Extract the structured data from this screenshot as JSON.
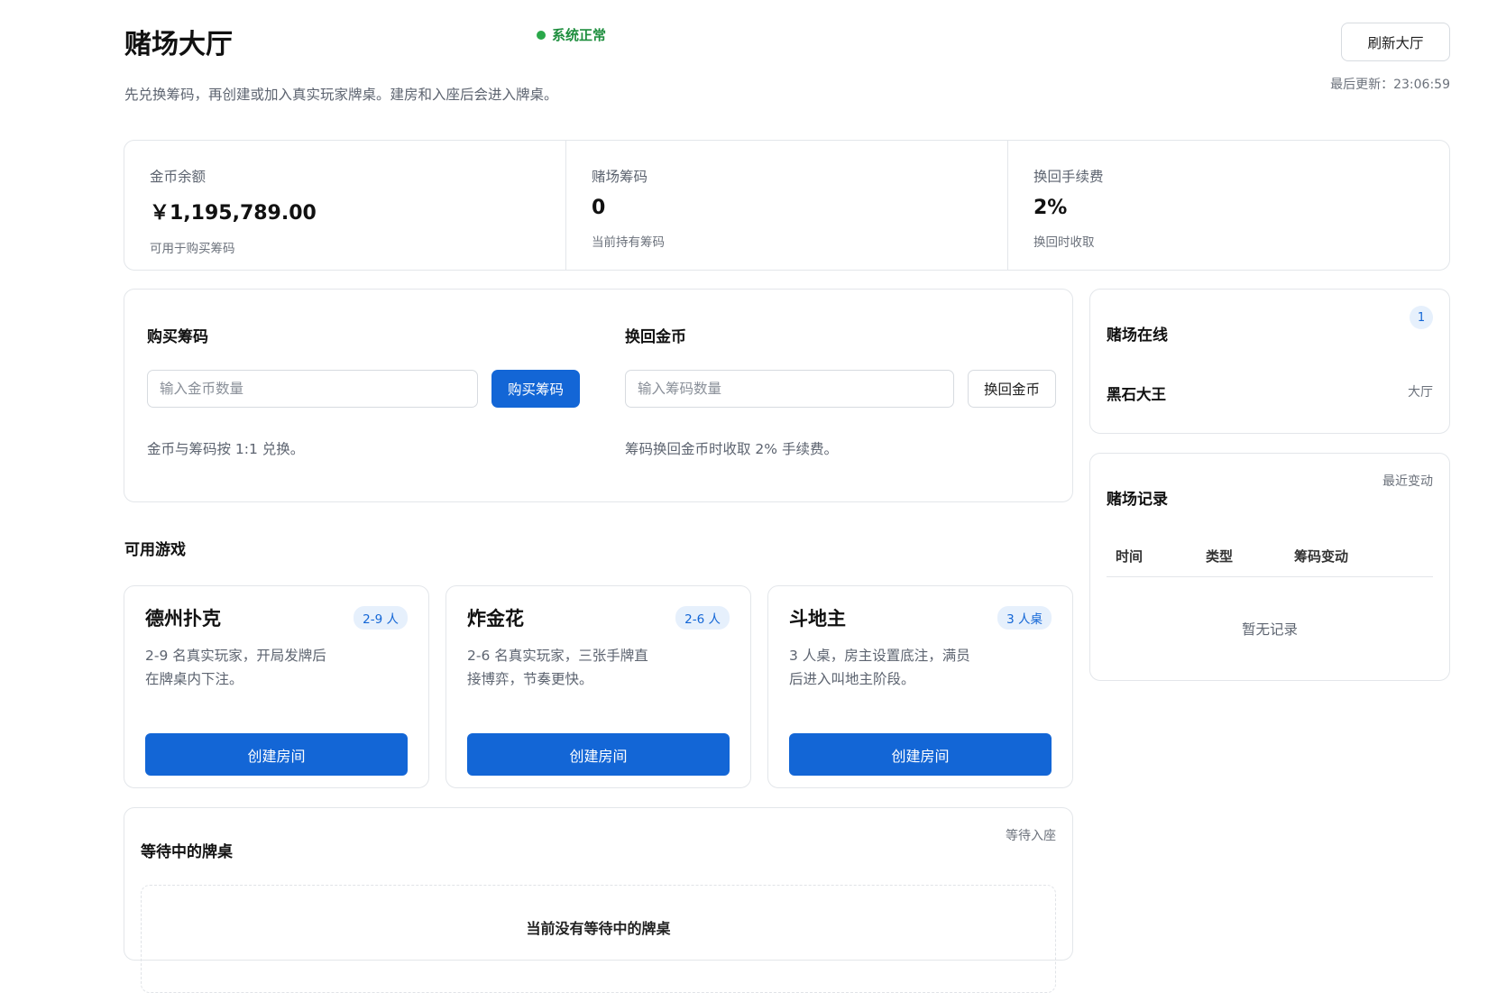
{
  "header": {
    "title": "赌场大厅",
    "status": "系统正常",
    "subtitle": "先兑换筹码，再创建或加入真实玩家牌桌。建房和入座后会进入牌桌。",
    "refresh_label": "刷新大厅",
    "last_update": "最后更新：23:06:59"
  },
  "stats": [
    {
      "label": "金币余额",
      "value": "￥1,195,789.00",
      "hint": "可用于购买筹码"
    },
    {
      "label": "赌场筹码",
      "value": "0",
      "hint": "当前持有筹码"
    },
    {
      "label": "换回手续费",
      "value": "2%",
      "hint": "换回时收取"
    }
  ],
  "buy": {
    "title": "购买筹码",
    "placeholder": "输入金币数量",
    "button": "购买筹码",
    "note": "金币与筹码按 1:1 兑换。"
  },
  "redeem": {
    "title": "换回金币",
    "placeholder": "输入筹码数量",
    "button": "换回金币",
    "note": "筹码换回金币时收取 2% 手续费。"
  },
  "games_title": "可用游戏",
  "games": [
    {
      "name": "德州扑克",
      "badge": "2-9 人",
      "desc": "2-9 名真实玩家，开局发牌后在牌桌内下注。",
      "button": "创建房间"
    },
    {
      "name": "炸金花",
      "badge": "2-6 人",
      "desc": "2-6 名真实玩家，三张手牌直接博弈，节奏更快。",
      "button": "创建房间"
    },
    {
      "name": "斗地主",
      "badge": "3 人桌",
      "desc": "3 人桌，房主设置底注，满员后进入叫地主阶段。",
      "button": "创建房间"
    }
  ],
  "waiting": {
    "title": "等待中的牌桌",
    "side": "等待入座",
    "empty": "当前没有等待中的牌桌"
  },
  "online": {
    "title": "赌场在线",
    "count": "1",
    "users": [
      {
        "name": "黑石大王",
        "location": "大厅"
      }
    ]
  },
  "records": {
    "title": "赌场记录",
    "side": "最近变动",
    "columns": [
      "时间",
      "类型",
      "筹码变动"
    ],
    "empty": "暂无记录"
  },
  "colors": {
    "primary": "#1366d6",
    "status_green": "#1e8e3e",
    "badge_bg": "#e6f0fc"
  }
}
